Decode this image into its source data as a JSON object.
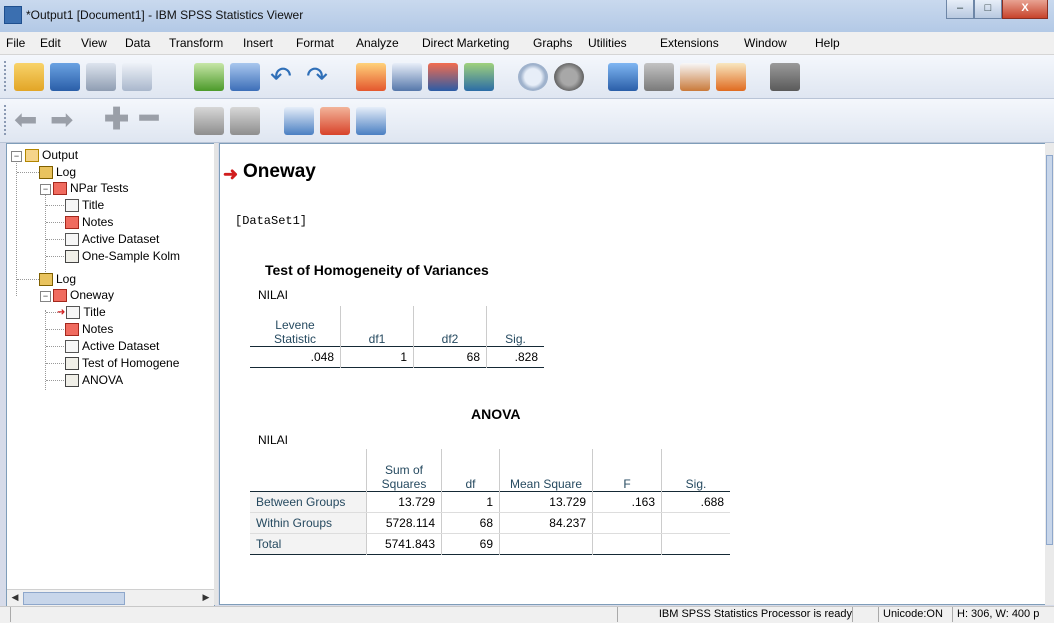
{
  "window": {
    "title": "*Output1 [Document1] - IBM SPSS Statistics Viewer",
    "minimize": "–",
    "maximize": "□",
    "close": "X"
  },
  "menu": [
    "File",
    "Edit",
    "View",
    "Data",
    "Transform",
    "Insert",
    "Format",
    "Analyze",
    "Direct Marketing",
    "Graphs",
    "Utilities",
    "Extensions",
    "Window",
    "Help"
  ],
  "navigator": {
    "items": [
      {
        "label": "Output",
        "icon": "output-book-icon"
      },
      {
        "label": "Log",
        "icon": "log-icon"
      },
      {
        "label": "NPar Tests",
        "icon": "procedure-book-icon"
      },
      {
        "label": "Title",
        "icon": "title-icon"
      },
      {
        "label": "Notes",
        "icon": "notes-icon"
      },
      {
        "label": "Active Dataset",
        "icon": "active-dataset-icon"
      },
      {
        "label": "One-Sample Kolm",
        "icon": "table-icon"
      },
      {
        "label": "Log",
        "icon": "log-icon"
      },
      {
        "label": "Oneway",
        "icon": "procedure-book-icon"
      },
      {
        "label": "Title",
        "icon": "title-icon"
      },
      {
        "label": "Notes",
        "icon": "notes-icon"
      },
      {
        "label": "Active Dataset",
        "icon": "active-dataset-icon"
      },
      {
        "label": "Test of Homogene",
        "icon": "table-icon"
      },
      {
        "label": "ANOVA",
        "icon": "table-icon"
      }
    ]
  },
  "output": {
    "heading": "Oneway",
    "dataset": "[DataSet1]",
    "homogeneity": {
      "title": "Test of Homogeneity of Variances",
      "variable": "NILAI",
      "headers": [
        "Levene\nStatistic",
        "df1",
        "df2",
        "Sig."
      ],
      "row": [
        ".048",
        "1",
        "68",
        ".828"
      ]
    },
    "anova": {
      "title": "ANOVA",
      "variable": "NILAI",
      "headers": [
        "",
        "Sum of\nSquares",
        "df",
        "Mean Square",
        "F",
        "Sig."
      ],
      "rows": [
        [
          "Between Groups",
          "13.729",
          "1",
          "13.729",
          ".163",
          ".688"
        ],
        [
          "Within Groups",
          "5728.114",
          "68",
          "84.237",
          "",
          ""
        ],
        [
          "Total",
          "5741.843",
          "69",
          "",
          "",
          ""
        ]
      ]
    }
  },
  "status": {
    "processor": "IBM SPSS Statistics Processor is ready",
    "unicode": "Unicode:ON",
    "size": "H: 306, W: 400 p"
  }
}
